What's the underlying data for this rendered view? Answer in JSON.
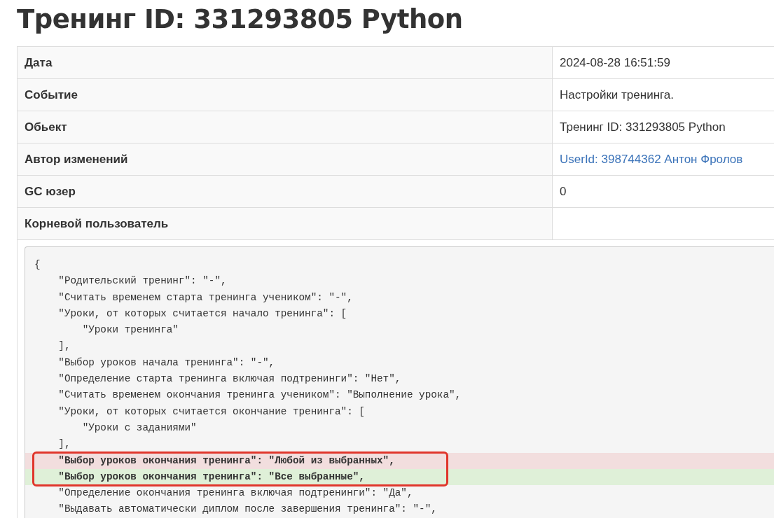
{
  "title": "Тренинг ID: 331293805 Python",
  "rows": [
    {
      "label": "Дата",
      "value": "2024-08-28 16:51:59",
      "kind": "text"
    },
    {
      "label": "Событие",
      "value": "Настройки тренинга.",
      "kind": "text"
    },
    {
      "label": "Обьект",
      "value": "Тренинг ID: 331293805 Python",
      "kind": "text"
    },
    {
      "label": "Автор изменений",
      "value": "UserId: 398744362 Антон Фролов",
      "kind": "link"
    },
    {
      "label": "GC юзер",
      "value": "0",
      "kind": "text"
    },
    {
      "label": "Корневой пользователь"
    }
  ],
  "code_lines": [
    {
      "text": "{",
      "kind": "plain",
      "marked": false
    },
    {
      "text": "    \"Родительский тренинг\": \"-\",",
      "kind": "plain",
      "marked": false
    },
    {
      "text": "    \"Считать временем старта тренинга учеником\": \"-\",",
      "kind": "plain",
      "marked": false
    },
    {
      "text": "    \"Уроки, от которых считается начало тренинга\": [",
      "kind": "plain",
      "marked": false
    },
    {
      "text": "        \"Уроки тренинга\"",
      "kind": "plain",
      "marked": false
    },
    {
      "text": "    ],",
      "kind": "plain",
      "marked": false
    },
    {
      "text": "    \"Выбор уроков начала тренинга\": \"-\",",
      "kind": "plain",
      "marked": false
    },
    {
      "text": "    \"Определение старта тренинга включая подтренинги\": \"Нет\",",
      "kind": "plain",
      "marked": false
    },
    {
      "text": "    \"Считать временем окончания тренинга учеником\": \"Выполнение урока\",",
      "kind": "plain",
      "marked": false
    },
    {
      "text": "    \"Уроки, от которых считается окончание тренинга\": [",
      "kind": "plain",
      "marked": false
    },
    {
      "text": "        \"Уроки с заданиями\"",
      "kind": "plain",
      "marked": false
    },
    {
      "text": "    ],",
      "kind": "plain",
      "marked": false
    },
    {
      "text": "    \"Выбор уроков окончания тренинга\": \"Любой из выбранных\",",
      "kind": "removed",
      "marked": true
    },
    {
      "text": "    \"Выбор уроков окончания тренинга\": \"Все выбранные\",",
      "kind": "added",
      "marked": true
    },
    {
      "text": "    \"Определение окончания тренинга включая подтренинги\": \"Да\",",
      "kind": "plain",
      "marked": false
    },
    {
      "text": "    \"Выдавать автоматически диплом после завершения тренинга\": \"-\",",
      "kind": "plain",
      "marked": false
    }
  ]
}
